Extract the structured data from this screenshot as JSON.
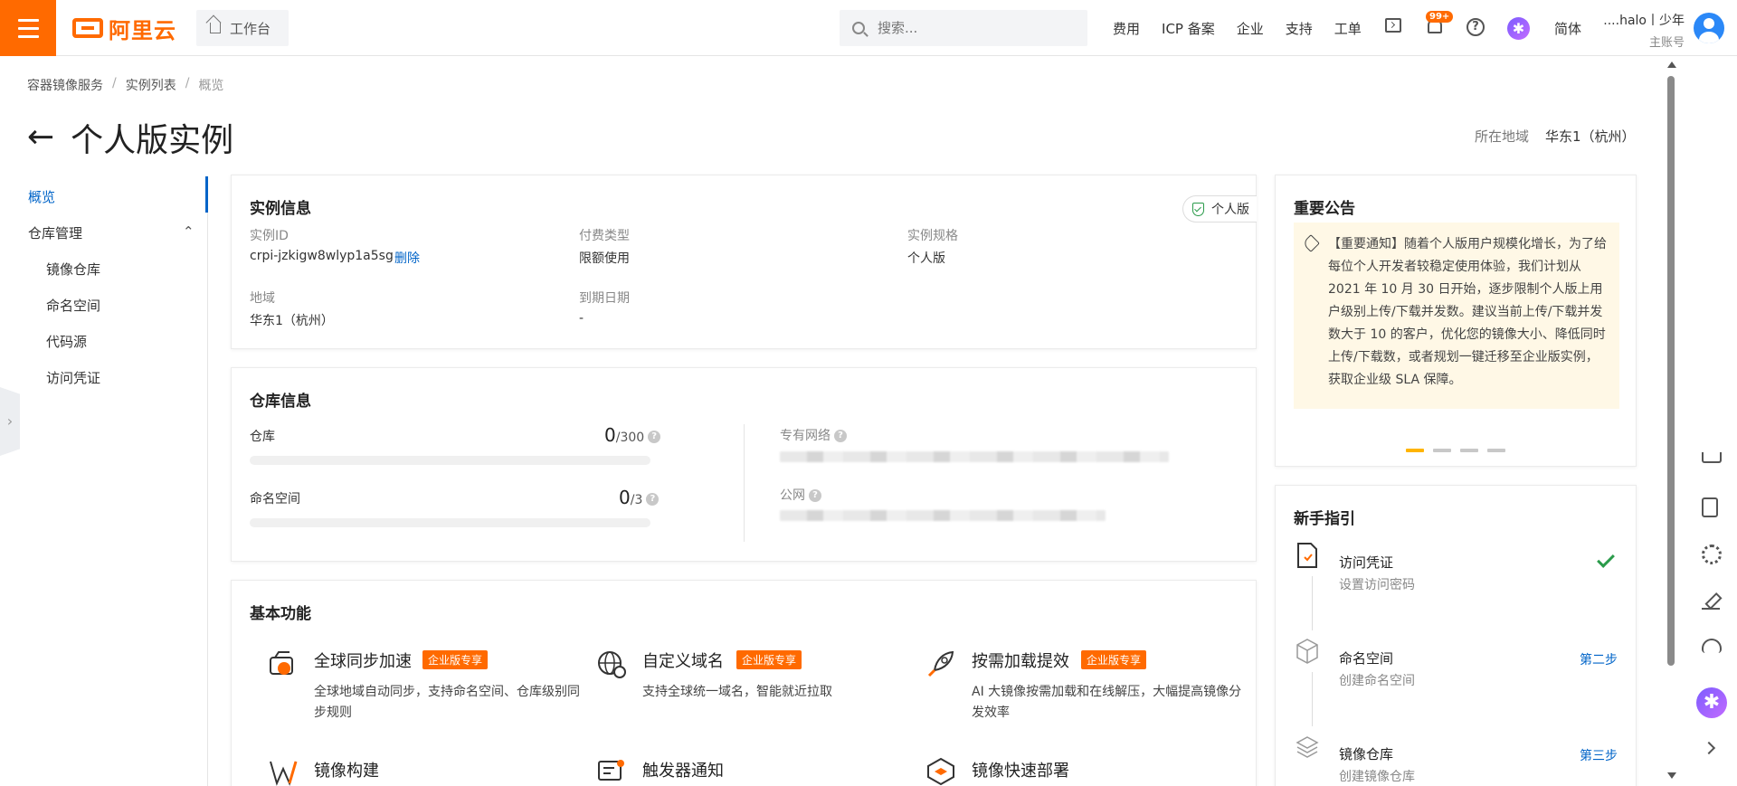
{
  "topbar": {
    "logo_text": "阿里云",
    "workbench": "工作台",
    "search_placeholder": "搜索...",
    "nav": [
      "费用",
      "ICP 备案",
      "企业",
      "支持",
      "工单"
    ],
    "bell_badge": "99+",
    "help": "?",
    "ai_glyph": "✱",
    "lang": "简体",
    "user_name": "....halo丨少年",
    "user_sub": "主账号"
  },
  "breadcrumb": [
    "容器镜像服务",
    "实例列表",
    "概览"
  ],
  "page": {
    "back": "←",
    "title": "个人版实例",
    "region_label": "所在地域",
    "region_value": "华东1（杭州）"
  },
  "leftnav": {
    "overview": "概览",
    "repo_mgmt": "仓库管理",
    "items": [
      "镜像仓库",
      "命名空间",
      "代码源",
      "访问凭证"
    ],
    "collapse_glyph": "›"
  },
  "instance_info": {
    "title": "实例信息",
    "badge": "个人版",
    "id_label": "实例ID",
    "id_value": "crpi-jzkigw8wlyp1a5sg",
    "delete": "删除",
    "pay_label": "付费类型",
    "pay_value": "限额使用",
    "spec_label": "实例规格",
    "spec_value": "个人版",
    "region_label": "地域",
    "region_value": "华东1（杭州）",
    "expire_label": "到期日期",
    "expire_value": "-"
  },
  "repo_info": {
    "title": "仓库信息",
    "repo_label": "仓库",
    "repo_used": "0",
    "repo_total": "/300",
    "repo_fraction": 0,
    "ns_label": "命名空间",
    "ns_used": "0",
    "ns_total": "/3",
    "ns_fraction": 0,
    "vpc_label": "专有网络",
    "public_label": "公网",
    "q": "?"
  },
  "features": {
    "title": "基本功能",
    "items": [
      {
        "name": "全球同步加速",
        "tag": "企业版专享",
        "desc": "全球地域自动同步，支持命名空间、仓库级别同步规则"
      },
      {
        "name": "自定义域名",
        "tag": "企业版专享",
        "desc": "支持全球统一域名，智能就近拉取"
      },
      {
        "name": "按需加载提效",
        "tag": "企业版专享",
        "desc": "AI 大镜像按需加载和在线解压，大幅提高镜像分发效率"
      },
      {
        "name": "镜像构建",
        "tag": "",
        "desc": ""
      },
      {
        "name": "触发器通知",
        "tag": "",
        "desc": ""
      },
      {
        "name": "镜像快速部署",
        "tag": "",
        "desc": ""
      }
    ]
  },
  "notice": {
    "title": "重要公告",
    "text": "【重要通知】随着个人版用户规模化增长，为了给每位个人开发者较稳定使用体验，我们计划从 2021 年 10 月 30 日开始，逐步限制个人版上用户级别上传/下载并发数。建议当前上传/下载并发数大于 10 的客户，优化您的镜像大小、降低同时上传/下载数，或者规划一键迁移至企业版实例，获取企业级 SLA 保障。"
  },
  "guide": {
    "title": "新手指引",
    "steps": [
      {
        "title": "访问凭证",
        "sub": "设置访问密码",
        "right": ""
      },
      {
        "title": "命名空间",
        "sub": "创建命名空间",
        "right": "第二步"
      },
      {
        "title": "镜像仓库",
        "sub": "创建镜像仓库",
        "right": "第三步"
      }
    ]
  },
  "floatbar": {
    "ai_glyph": "✱"
  },
  "colors": {
    "brand": "#ff6a00",
    "link": "#0064c8",
    "success": "#2a9b4a"
  }
}
